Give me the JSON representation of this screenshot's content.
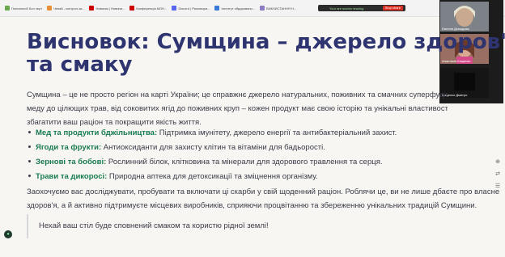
{
  "browser": {
    "bookmarks": [
      {
        "label": "Полинолоб бол черт",
        "color": "#6aa84f"
      },
      {
        "label": "Чепай - контрол за...",
        "color": "#e69138"
      },
      {
        "label": "Новачок | Новини...",
        "color": "#cc0000"
      },
      {
        "label": "Конференція МОН...",
        "color": "#cc0000"
      },
      {
        "label": "Discord | Разговори...",
        "color": "#5865f2"
      },
      {
        "label": "Інститут обдаровано...",
        "color": "#3c78d8"
      },
      {
        "label": "ВИКЛИСТАННЯ Н...",
        "color": "#8e7cc3"
      }
    ],
    "share_notice": "Your are screen sharing",
    "stop_share": "Stop share"
  },
  "participants": [
    {
      "name": "Євгенія Демидова"
    },
    {
      "name": "Анастасія Кащенко"
    },
    {
      "name": "Кащенко Дмитро"
    }
  ],
  "slide": {
    "title_line1": "Висновок: Сумщина – джерело здоров'я",
    "title_line2": "та смаку",
    "intro_lines": [
      "Сумщина – це не просто регіон на карті України; це справжнє джерело натуральних, поживних та смачних суперфудів. Від со",
      "меду до цілющих трав, від соковитих ягід до поживних круп – кожен продукт має свою історію та унікальні властивості, що здатні",
      "збагатити ваш раціон та покращити якість життя."
    ],
    "items": [
      {
        "label": "Мед та продукти бджільництва:",
        "text": " Підтримка імунітету, джерело енергії та антибактеріальний захист."
      },
      {
        "label": "Ягоди та фрукти:",
        "text": " Антиоксиданти для захисту клітин та вітаміни для бадьорості."
      },
      {
        "label": "Зернові та бобові:",
        "text": " Рослинний білок, клітковина та мінерали для здорового травлення та серця."
      },
      {
        "label": "Трави та дикоросі:",
        "text": " Природна аптека для детоксикації та зміцнення організму."
      }
    ],
    "outro_lines": [
      "Заохочуємо вас досліджувати, пробувати та включати ці скарби у свій щоденний раціон. Роблячи це, ви не лише дбаєте про власне",
      "здоров'я, а й активно підтримуєте місцевих виробників, сприяючи процвітанню та збереженню унікальних традицій Сумщини."
    ],
    "quote": "Нехай ваш стіл буде сповнений смаком та користю рідної землі!"
  },
  "colors": {
    "title": "#2e3470",
    "accent": "#177b4f",
    "text": "#3b3b4a",
    "background": "#f7f6f2"
  },
  "icons": [
    "bookmark-icon",
    "share-screen-icon",
    "zoom-icon",
    "translate-icon",
    "chat-icon",
    "app-badge-icon"
  ]
}
